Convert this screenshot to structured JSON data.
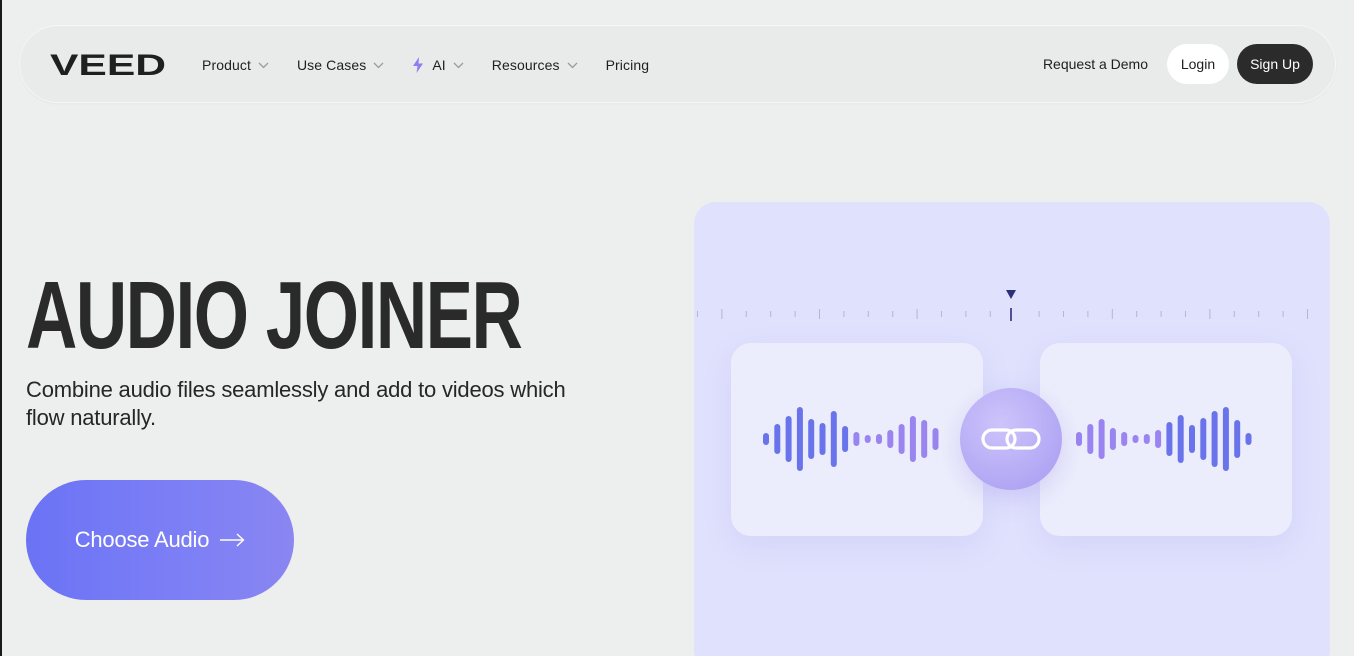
{
  "brand": {
    "logo_text": "VEED"
  },
  "nav": {
    "items": [
      {
        "label": "Product",
        "has_dropdown": true
      },
      {
        "label": "Use Cases",
        "has_dropdown": true
      },
      {
        "label": "AI",
        "has_dropdown": true,
        "icon": "bolt-icon"
      },
      {
        "label": "Resources",
        "has_dropdown": true
      },
      {
        "label": "Pricing",
        "has_dropdown": false
      }
    ],
    "request_demo": "Request a Demo",
    "login": "Login",
    "signup": "Sign Up"
  },
  "hero": {
    "title": "AUDIO JOINER",
    "subtitle": "Combine audio files seamlessly and add to videos which flow naturally.",
    "cta_label": "Choose Audio"
  },
  "colors": {
    "accent": "#6b73f5",
    "accent_purple": "#9a84f0",
    "illustration_bg": "#e0e1fd",
    "dark_button": "#2b2b2b",
    "page_bg": "#edeeee"
  },
  "icons": {
    "ai": "bolt-icon",
    "cta": "arrow-right-icon",
    "link": "link-icon",
    "playhead": "playhead-marker-icon"
  }
}
